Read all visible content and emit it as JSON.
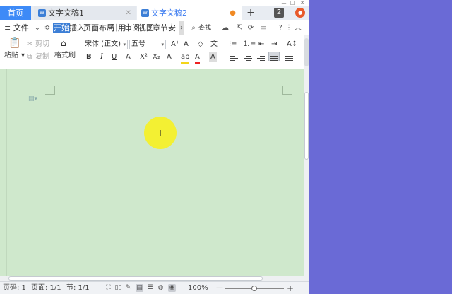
{
  "tabs": {
    "home": "首页",
    "doc1": "文字文稿1",
    "doc2": "文字文稿2",
    "new_tab": "+"
  },
  "menu": {
    "file": "≡ 文件",
    "items": [
      "开始",
      "插入",
      "页面布局",
      "引用",
      "审阅",
      "视图",
      "章节",
      "安"
    ],
    "search": "查找"
  },
  "ribbon": {
    "paste": "粘贴",
    "cut": "剪切",
    "copy": "复制",
    "format_painter": "格式刷",
    "font_name": "宋体 (正文)",
    "font_size": "五号",
    "bold": "B",
    "italic": "I",
    "underline": "U",
    "strike": "A",
    "superscript": "X²",
    "subscript": "X₂",
    "grow_font": "A⁺",
    "shrink_font": "A⁻",
    "clear_format": "◇",
    "phonetic": "文",
    "text_effect": "A",
    "highlight": "ab",
    "font_color": "A",
    "char_shade": "A"
  },
  "statusbar": {
    "page_num": "页码: 1",
    "pages": "页面: 1/1",
    "section": "节: 1/1",
    "zoom": "100%",
    "zoom_minus": "—",
    "zoom_plus": "+"
  },
  "colors": {
    "accent": "#3d7fd6",
    "home_tab": "#3d8af7",
    "doc_bg": "#cfe8cc",
    "highlight": "#f4f02a",
    "desktop": "#6a6ad6"
  }
}
